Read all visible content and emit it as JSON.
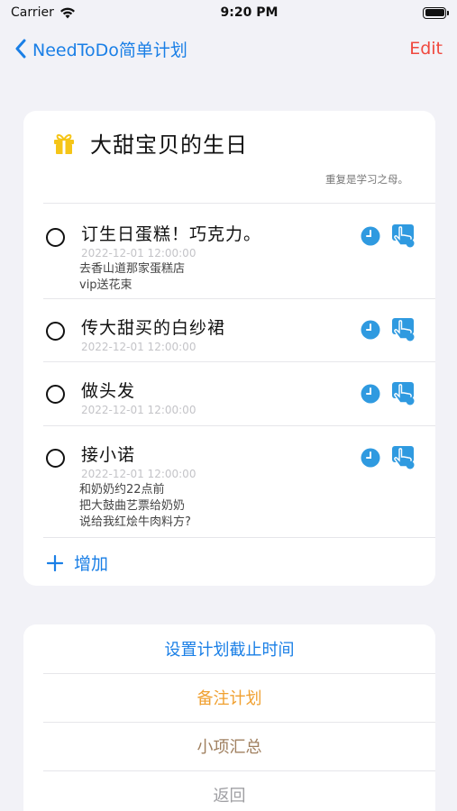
{
  "status_bar": {
    "carrier": "Carrier",
    "time": "9:20 PM"
  },
  "nav": {
    "back_label": "NeedToDo简单计划",
    "edit_label": "Edit"
  },
  "plan": {
    "title": "大甜宝贝的生日",
    "subtitle": "重复是学习之母。",
    "icon": "gift-icon",
    "tasks": [
      {
        "title": "订生日蛋糕！巧克力。",
        "time": "2022-12-01 12:00:00",
        "notes": [
          "去香山道那家蛋糕店",
          "vip送花束"
        ]
      },
      {
        "title": "传大甜买的白纱裙",
        "time": "2022-12-01 12:00:00",
        "notes": []
      },
      {
        "title": "做头发",
        "time": "2022-12-01 12:00:00",
        "notes": []
      },
      {
        "title": "接小诺",
        "time": "2022-12-01 12:00:00",
        "notes": [
          "和奶奶约22点前",
          "把大鼓曲艺票给奶奶",
          "说给我红烩牛肉料方?"
        ]
      }
    ],
    "add_label": "增加"
  },
  "actions": {
    "set_deadline": "设置计划截止时间",
    "note_plan": "备注计划",
    "summary": "小项汇总",
    "back": "返回"
  },
  "colors": {
    "accent_blue": "#1a7fe6",
    "edit_red": "#f0483e",
    "note_orange": "#f0a030",
    "summary_brown": "#a08060",
    "back_gray": "#a0a0a4",
    "icon_blue": "#2f9ae0",
    "gift_yellow": "#f5c518"
  }
}
